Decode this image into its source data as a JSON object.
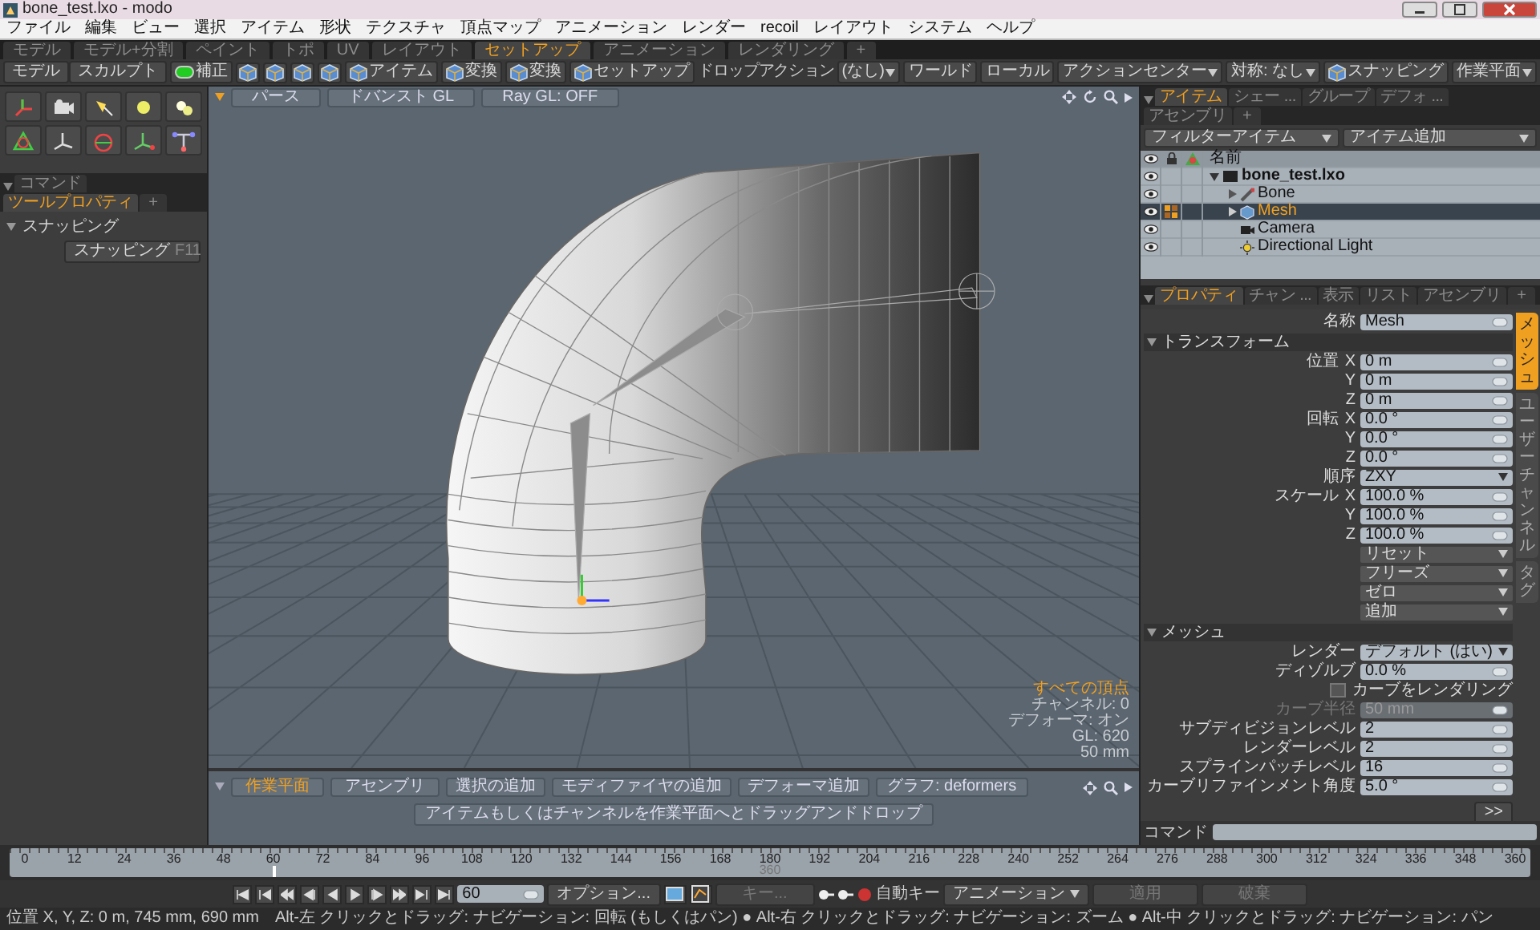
{
  "window": {
    "title": "bone_test.lxo - modo"
  },
  "menu": [
    "ファイル",
    "編集",
    "ビュー",
    "選択",
    "アイテム",
    "形状",
    "テクスチャ",
    "頂点マップ",
    "アニメーション",
    "レンダー",
    "recoil",
    "レイアウト",
    "システム",
    "ヘルプ"
  ],
  "layout_tabs": [
    {
      "label": "モデル",
      "selected": false
    },
    {
      "label": "モデル+分割",
      "selected": false
    },
    {
      "label": "ペイント",
      "selected": false
    },
    {
      "label": "トポ",
      "selected": false
    },
    {
      "label": "UV",
      "selected": false
    },
    {
      "label": "レイアウト",
      "selected": false
    },
    {
      "label": "セットアップ",
      "selected": true
    },
    {
      "label": "アニメーション",
      "selected": false
    },
    {
      "label": "レンダリング",
      "selected": false
    }
  ],
  "layout_add": "+",
  "mode_buttons": [
    "モデル",
    "スカルプト"
  ],
  "toolbar": [
    {
      "kind": "toggle",
      "label": "補正",
      "on": true
    },
    {
      "kind": "icon-button"
    },
    {
      "kind": "icon-button"
    },
    {
      "kind": "icon-button"
    },
    {
      "kind": "icon-button"
    },
    {
      "kind": "icon-text-button",
      "label": "アイテム"
    },
    {
      "kind": "icon-text-button",
      "label": "変換"
    },
    {
      "kind": "icon-text-button",
      "label": "変換"
    },
    {
      "kind": "icon-text-button",
      "label": "セットアップ"
    },
    {
      "kind": "label",
      "label": "ドロップアクション"
    },
    {
      "kind": "dropdown",
      "label": "(なし)"
    },
    {
      "kind": "button",
      "label": "ワールド"
    },
    {
      "kind": "button",
      "label": "ローカル"
    },
    {
      "kind": "dropdown",
      "label": "アクションセンター"
    },
    {
      "kind": "dropdown",
      "label": "対称: なし"
    },
    {
      "kind": "icon-text-button",
      "label": "スナッピング"
    },
    {
      "kind": "dropdown",
      "label": "作業平面"
    }
  ],
  "left_panel": {
    "tabs": [
      {
        "label": "コマンド",
        "selected": false
      },
      {
        "label": "ツールプロパティ",
        "selected": true
      }
    ],
    "add_tab": "+",
    "section": {
      "label": "スナッピング",
      "expanded": true
    },
    "snapping_button": {
      "label": "スナッピング",
      "shortcut": "F11"
    }
  },
  "viewport": {
    "view_buttons": [
      "パース",
      "ドバンスト GL",
      "Ray GL: OFF"
    ],
    "info": [
      "すべての頂点",
      "チャンネル: 0",
      "デフォーマ: オン",
      "GL: 620",
      "50 mm"
    ]
  },
  "schematic": {
    "tabs": [
      {
        "label": "作業平面",
        "selected": true
      },
      {
        "label": "アセンブリ",
        "selected": false
      }
    ],
    "buttons": [
      "選択の追加",
      "モディファイヤの追加",
      "デフォーマ追加"
    ],
    "graph": "グラフ: deformers",
    "hint": "アイテムもしくはチャンネルを作業平面へとドラッグアンドドロップ"
  },
  "items_panel": {
    "tabs": [
      {
        "label": "アイテム",
        "selected": true
      },
      {
        "label": "シェー ...",
        "selected": false
      },
      {
        "label": "グループ",
        "selected": false
      },
      {
        "label": "デフォ ...",
        "selected": false
      },
      {
        "label": "アセンブリ",
        "selected": false
      }
    ],
    "add_tab": "+",
    "filter": "フィルターアイテム",
    "add_item": "アイテム追加",
    "column": "名前",
    "tree": [
      {
        "label": "bone_test.lxo",
        "kind": "scene",
        "expanded": true,
        "selected": false,
        "children": [
          {
            "label": "Bone",
            "kind": "bone",
            "expanded": false,
            "selected": false
          },
          {
            "label": "Mesh",
            "kind": "mesh",
            "expanded": false,
            "selected": true
          },
          {
            "label": "Camera",
            "kind": "camera",
            "selected": false
          },
          {
            "label": "Directional Light",
            "kind": "light",
            "selected": false
          }
        ]
      }
    ]
  },
  "properties": {
    "tabs": [
      {
        "label": "プロパティ",
        "selected": true
      },
      {
        "label": "チャン ...",
        "selected": false
      },
      {
        "label": "表示",
        "selected": false
      },
      {
        "label": "リスト",
        "selected": false
      },
      {
        "label": "アセンブリ",
        "selected": false
      }
    ],
    "add_tab": "+",
    "side_tabs": [
      {
        "label": "メッシュ",
        "selected": true
      },
      {
        "label": "ユーザーチャンネル",
        "selected": false
      },
      {
        "label": "タグ",
        "selected": false
      }
    ],
    "rows": [
      {
        "kind": "field",
        "label": "名称",
        "value": "Mesh",
        "disabled": false
      },
      {
        "kind": "section",
        "label": "トランスフォーム",
        "expanded": true
      },
      {
        "kind": "vector",
        "label": "位置",
        "axis": "X",
        "value": "0 m"
      },
      {
        "kind": "vector",
        "axis": "Y",
        "value": "0 m"
      },
      {
        "kind": "vector",
        "axis": "Z",
        "value": "0 m"
      },
      {
        "kind": "vector",
        "label": "回転",
        "axis": "X",
        "value": "0.0 °"
      },
      {
        "kind": "vector",
        "axis": "Y",
        "value": "0.0 °"
      },
      {
        "kind": "vector",
        "axis": "Z",
        "value": "0.0 °"
      },
      {
        "kind": "dropdown",
        "label": "順序",
        "value": "ZXY"
      },
      {
        "kind": "vector",
        "label": "スケール",
        "axis": "X",
        "value": "100.0 %"
      },
      {
        "kind": "vector",
        "axis": "Y",
        "value": "100.0 %"
      },
      {
        "kind": "vector",
        "axis": "Z",
        "value": "100.0 %"
      },
      {
        "kind": "action",
        "value": "リセット"
      },
      {
        "kind": "action",
        "value": "フリーズ"
      },
      {
        "kind": "action",
        "value": "ゼロ"
      },
      {
        "kind": "action",
        "value": "追加"
      },
      {
        "kind": "section",
        "label": "メッシュ",
        "expanded": true
      },
      {
        "kind": "dropdown",
        "label": "レンダー",
        "value": "デフォルト (はい)"
      },
      {
        "kind": "field",
        "label": "ディゾルブ",
        "value": "0.0 %",
        "disabled": false
      },
      {
        "kind": "checkbox",
        "label": "カーブをレンダリング",
        "checked": false
      },
      {
        "kind": "field",
        "label": "カーブ半径",
        "value": "50 mm",
        "disabled": true
      },
      {
        "kind": "field",
        "label": "サブディビジョンレベル",
        "value": "2",
        "disabled": false
      },
      {
        "kind": "field",
        "label": "レンダーレベル",
        "value": "2",
        "disabled": false
      },
      {
        "kind": "field",
        "label": "スプラインパッチレベル",
        "value": "16",
        "disabled": false
      },
      {
        "kind": "field",
        "label": "カーブリファインメント角度",
        "value": "5.0 °",
        "disabled": false
      }
    ],
    "more": ">>"
  },
  "command": {
    "label": "コマンド"
  },
  "timeline": {
    "ticks": [
      "0",
      "12",
      "24",
      "36",
      "48",
      "60",
      "72",
      "84",
      "96",
      "108",
      "120",
      "132",
      "144",
      "156",
      "168",
      "180",
      "192",
      "204",
      "216",
      "228",
      "240",
      "252",
      "264",
      "276",
      "288",
      "300",
      "312",
      "324",
      "336",
      "348",
      "360"
    ],
    "range_label": "360",
    "playhead": {
      "level": 0.1667
    }
  },
  "playback": {
    "frame": "60",
    "options": "オプション...",
    "key": {
      "label": "キー...",
      "disabled": true
    },
    "auto_key": "自動キー",
    "mode": "アニメーション",
    "actions": [
      {
        "label": "適用",
        "disabled": true
      },
      {
        "label": "破棄",
        "disabled": true
      }
    ]
  },
  "status": {
    "position": "位置 X, Y, Z:  0 m, 745 mm, 690 mm",
    "hint": "Alt-左 クリックとドラッグ: ナビゲーション: 回転 (もしくはパン) ● Alt-右 クリックとドラッグ: ナビゲーション: ズーム ● Alt-中 クリックとドラッグ: ナビゲーション: パン"
  }
}
